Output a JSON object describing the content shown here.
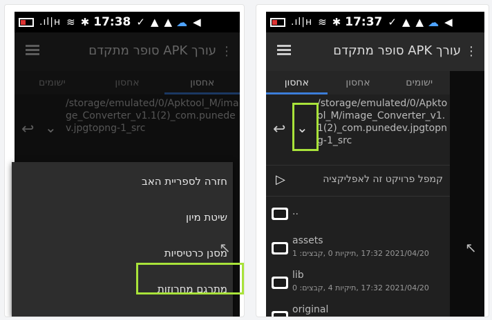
{
  "status": {
    "left_time": "17:38",
    "right_time": "17:37"
  },
  "toolbar": {
    "title": "עורך APK סופר מתקדם"
  },
  "tabs": [
    "ישומים",
    "אחסון",
    "אחסון"
  ],
  "path": "/storage/emulated/0/Apktool_M/image_Converter_v1.1(2)_com.punedev.jpgtopng-1_src",
  "compile_label": "קמפל פרויקט זה לאפליקציה",
  "files": [
    {
      "name": "..",
      "meta": ""
    },
    {
      "name": "assets",
      "meta": "2021/04/20 17:32 ,תיקיות 0 ,קבצים: 1"
    },
    {
      "name": "lib",
      "meta": "2021/04/20 17:32 ,תיקיות 4 ,קבצים: 0"
    },
    {
      "name": "original",
      "meta": ""
    }
  ],
  "left_menu": [
    "חזרה לספריית האב",
    "שיטת מיון",
    "מסנן כרטיסיות",
    "מתרגם מחרוזות"
  ],
  "left_bottom": "original",
  "colors": {
    "highlight": "#a9e33a",
    "tab_accent": "#3c7dd9"
  }
}
